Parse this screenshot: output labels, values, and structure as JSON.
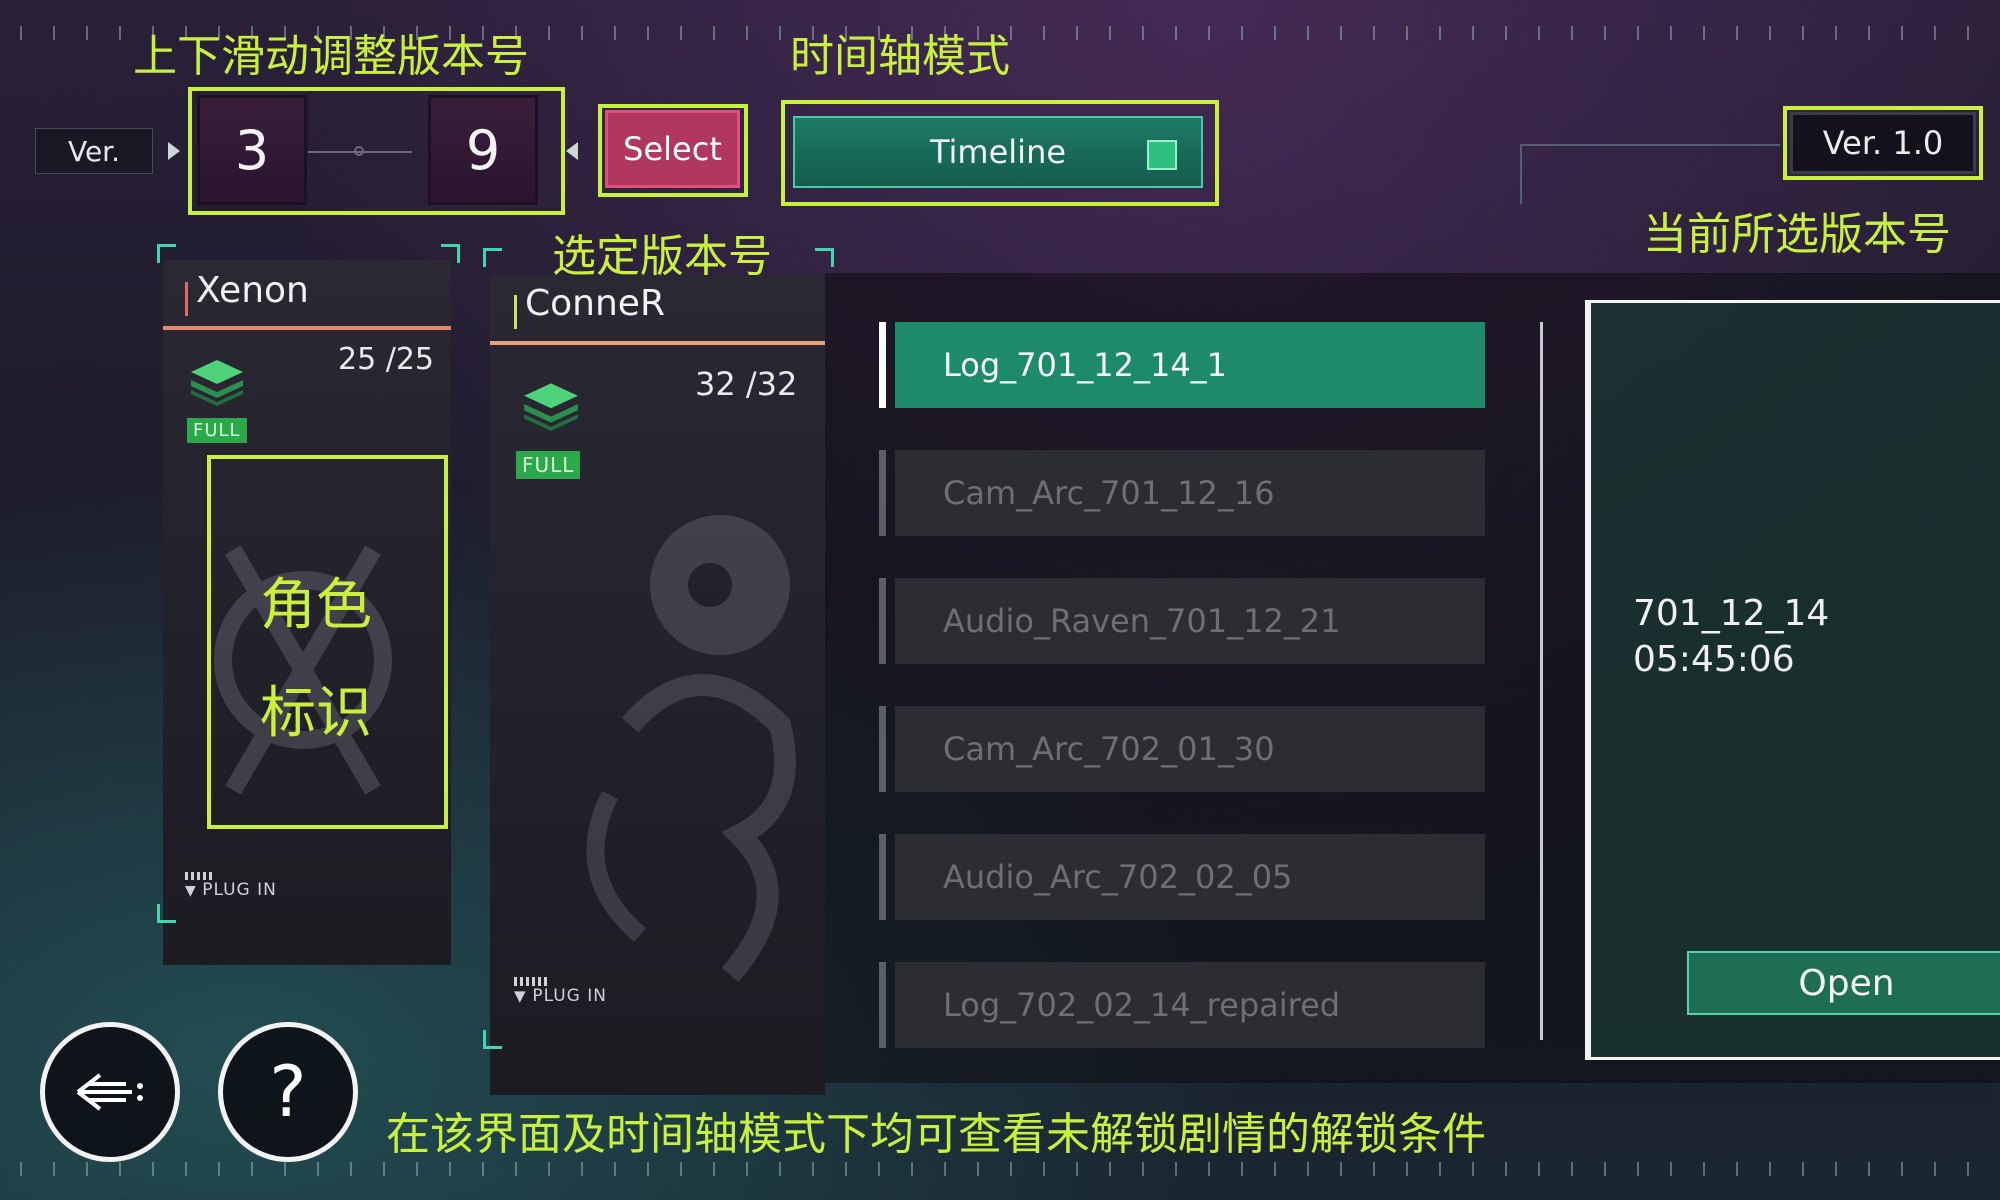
{
  "annotations": {
    "version_slide": "上下滑动调整版本号",
    "timeline_mode": "时间轴模式",
    "select_version": "选定版本号",
    "current_version": "当前所选版本号",
    "character_id_line1": "角色",
    "character_id_line2": "标识",
    "footer_note": "在该界面及时间轴模式下均可查看未解锁剧情的解锁条件"
  },
  "version_selector": {
    "ver_label": "Ver.",
    "major": "3",
    "minor": "9",
    "select_label": "Select"
  },
  "mode": {
    "timeline_label": "Timeline"
  },
  "current_version": {
    "label": "Ver. 1.0"
  },
  "characters": [
    {
      "name": "Xenon",
      "count": "25 /25",
      "badge": "FULL",
      "plugin": "PLUG IN"
    },
    {
      "name": "ConneR",
      "count": "32 /32",
      "badge": "FULL",
      "plugin": "PLUG IN"
    }
  ],
  "logs": [
    {
      "label": "Log_701_12_14_1",
      "active": true
    },
    {
      "label": "Cam_Arc_701_12_16",
      "active": false
    },
    {
      "label": "Audio_Raven_701_12_21",
      "active": false
    },
    {
      "label": "Cam_Arc_702_01_30",
      "active": false
    },
    {
      "label": "Audio_Arc_702_02_05",
      "active": false
    },
    {
      "label": "Log_702_02_14_repaired",
      "active": false
    }
  ],
  "detail": {
    "date": "701_12_14",
    "time": "05:45:06",
    "open_label": "Open"
  },
  "colors": {
    "annotation": "#c8f03c",
    "accent_green": "#1d8a6a",
    "select_pink": "#b0385e"
  },
  "icons": {
    "back": "back-arrow-icon",
    "help": "question-icon",
    "layers": "layers-icon"
  }
}
